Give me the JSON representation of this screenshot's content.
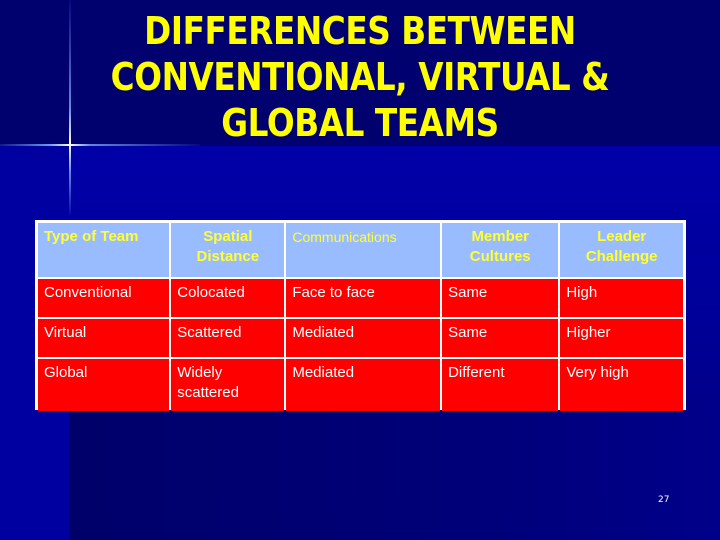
{
  "slide": {
    "title": "DIFFERENCES BETWEEN CONVENTIONAL, VIRTUAL & GLOBAL TEAMS",
    "title_lines": [
      "DIFFERENCES BETWEEN",
      "CONVENTIONAL, VIRTUAL &",
      "GLOBAL TEAMS"
    ],
    "page_number": "27",
    "colors": {
      "background": "#0000a0",
      "title": "#ffff00",
      "header_bg": "#99bbff",
      "header_text": "#ffff33",
      "cell_bg": "#ff0000",
      "cell_text": "#ffffff"
    }
  },
  "table": {
    "headers": [
      "Type of Team",
      "Spatial Distance",
      "Communications",
      "Member Cultures",
      "Leader Challenge"
    ],
    "rows": [
      [
        "Conventional",
        "Colocated",
        "Face to face",
        "Same",
        "High"
      ],
      [
        "Virtual",
        "Scattered",
        "Mediated",
        "Same",
        "Higher"
      ],
      [
        "Global",
        "Widely scattered",
        "Mediated",
        "Different",
        "Very high"
      ]
    ]
  }
}
